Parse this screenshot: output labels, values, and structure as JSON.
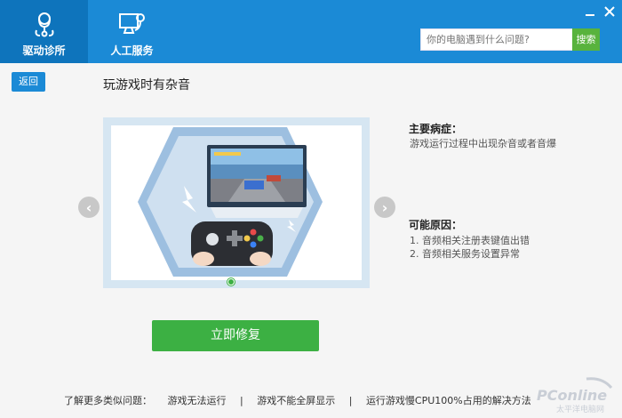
{
  "header": {
    "tabs": [
      {
        "label": "驱动诊所",
        "icon": "stethoscope-icon",
        "active": true
      },
      {
        "label": "人工服务",
        "icon": "monitor-stethoscope-icon",
        "active": false
      }
    ],
    "search": {
      "placeholder": "你的电脑遇到什么问题?",
      "button_label": "搜索"
    }
  },
  "main": {
    "back_label": "返回",
    "title": "玩游戏时有杂音",
    "symptom_heading": "主要病症：",
    "symptom_text": "游戏运行过程中出现杂音或者音爆",
    "causes_heading": "可能原因：",
    "causes": [
      "1. 音频相关注册表键值出错",
      "2. 音频相关服务设置异常"
    ],
    "fix_label": "立即修复",
    "carousel": {
      "left_arrow": "‹",
      "right_arrow": "›",
      "active_index": 0,
      "count": 1
    }
  },
  "footer": {
    "more_label": "了解更多类似问题：",
    "links": [
      "游戏无法运行",
      "游戏不能全屏显示",
      "运行游戏慢CPU100%占用的解决方法"
    ],
    "separator": "|"
  },
  "watermark": {
    "brand": "PConline",
    "sub": "太平洋电脑网"
  },
  "colors": {
    "header": "#1b8ad6",
    "active_tab": "#0e74bc",
    "green": "#3cb043",
    "search_green": "#58b33d"
  }
}
